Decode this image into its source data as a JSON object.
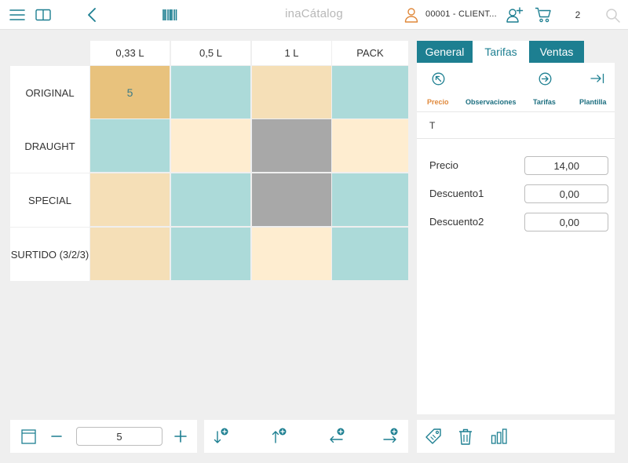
{
  "app": {
    "title": "inaCátalog"
  },
  "header": {
    "client": "00001 - CLIENT...",
    "cart_count": "2"
  },
  "colors": {
    "accent": "#1d7f91",
    "tan": "#f5dfb7",
    "tan_selected": "#e8c27d",
    "teal": "#acdad9",
    "cream": "#feedd0",
    "gray": "#a8a8a8",
    "orange": "#e0883a"
  },
  "grid": {
    "columns": [
      "0,33 L",
      "0,5 L",
      "1 L",
      "PACK"
    ],
    "rows": [
      {
        "label": "ORIGINAL",
        "cells": [
          {
            "value": "5",
            "color": "#e8c27d"
          },
          {
            "value": "",
            "color": "#acdad9"
          },
          {
            "value": "",
            "color": "#f5dfb7"
          },
          {
            "value": "",
            "color": "#acdad9"
          }
        ]
      },
      {
        "label": "DRAUGHT",
        "cells": [
          {
            "value": "",
            "color": "#acdad9"
          },
          {
            "value": "",
            "color": "#feedd0"
          },
          {
            "value": "",
            "color": "#a8a8a8"
          },
          {
            "value": "",
            "color": "#feedd0"
          }
        ]
      },
      {
        "label": "SPECIAL",
        "cells": [
          {
            "value": "",
            "color": "#f5dfb7"
          },
          {
            "value": "",
            "color": "#acdad9"
          },
          {
            "value": "",
            "color": "#a8a8a8"
          },
          {
            "value": "",
            "color": "#acdad9"
          }
        ]
      },
      {
        "label": "SURTIDO (3/2/3)",
        "cells": [
          {
            "value": "",
            "color": "#f5dfb7"
          },
          {
            "value": "",
            "color": "#acdad9"
          },
          {
            "value": "",
            "color": "#feedd0"
          },
          {
            "value": "",
            "color": "#acdad9"
          }
        ]
      }
    ]
  },
  "tabs": [
    {
      "label": "General"
    },
    {
      "label": "Tarifas"
    },
    {
      "label": "Ventas"
    }
  ],
  "subtabs": [
    {
      "label": "Precio"
    },
    {
      "label": "Observaciones"
    },
    {
      "label": "Tarifas"
    },
    {
      "label": "Plantilla"
    }
  ],
  "tarifa": {
    "t_label": "T",
    "fields": [
      {
        "label": "Precio",
        "value": "14,00"
      },
      {
        "label": "Descuento1",
        "value": "0,00"
      },
      {
        "label": "Descuento2",
        "value": "0,00"
      }
    ]
  },
  "quantity": {
    "value": "5"
  },
  "icons": {
    "menu": "menu-icon",
    "book": "book-icon",
    "back": "chevron-left-icon",
    "barcode": "barcode-icon",
    "user": "user-icon",
    "add_user": "add-user-icon",
    "cart": "cart-icon",
    "search": "search-icon",
    "window": "window-icon",
    "minus": "minus-icon",
    "plus": "plus-icon",
    "down_add": "arrow-down-add-icon",
    "up_add": "arrow-up-add-icon",
    "left_add": "arrow-left-add-icon",
    "right_add": "arrow-right-add-icon",
    "tag": "tag-icon",
    "trash": "trash-icon",
    "bar_chart": "bar-chart-icon",
    "nav_first": "arrow-circle-up-left-icon",
    "nav_next": "arrow-circle-right-icon",
    "nav_last": "arrow-to-end-icon"
  }
}
